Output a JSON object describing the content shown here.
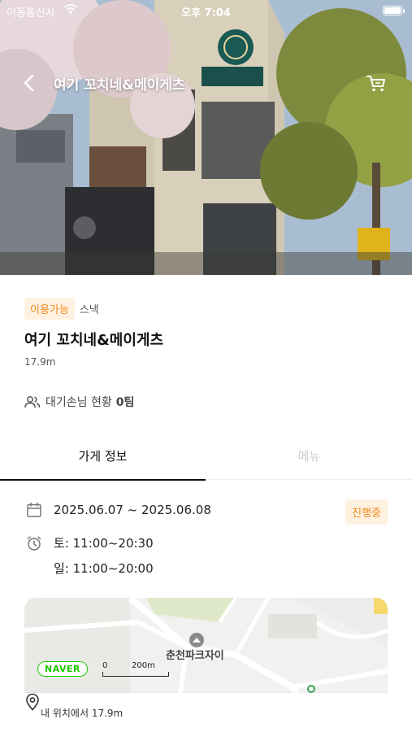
{
  "status_bar": {
    "carrier": "이동통신사",
    "time": "오후 7:04"
  },
  "header": {
    "title": "여기 꼬치네&메이게츠",
    "back_icon": "chevron-left-icon",
    "cart_icon": "cart-icon"
  },
  "store": {
    "availability_badge": "이용가능",
    "category": "스낵",
    "name": "여기 꼬치네&메이게츠",
    "distance": "17.9m",
    "waiting_label": "대기손님 현황",
    "waiting_count": "0팀"
  },
  "tabs": [
    {
      "label": "가게 정보",
      "active": true
    },
    {
      "label": "메뉴",
      "active": false
    }
  ],
  "details": {
    "date_range": "2025.06.07 ~ 2025.06.08",
    "status_badge": "진행중",
    "hours_sat": "토: 11:00~20:30",
    "hours_sun": "일: 11:00~20:00"
  },
  "map": {
    "provider": "NAVER",
    "scale_min": "0",
    "scale_max": "200m",
    "poi": "춘천파크자이",
    "location_text": "내 위치에서 17.9m"
  },
  "colors": {
    "accent": "#f08a1c",
    "accent_bg": "#fff1e0",
    "naver_green": "#1ec800"
  }
}
